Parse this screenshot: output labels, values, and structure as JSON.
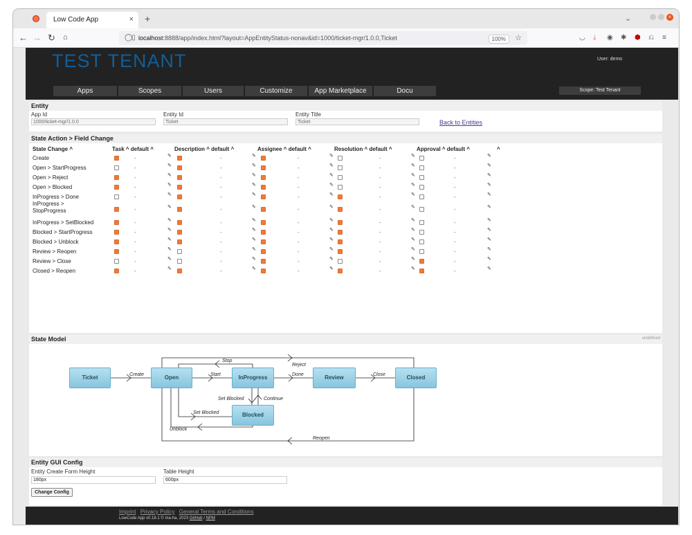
{
  "browser": {
    "tab_title": "Low Code App",
    "tab_close": "×",
    "new_tab": "+",
    "url_host": "localhost",
    "url_rest": ":8888/app/index.html?layout=AppEntityStatus-nonav&id=1000/ticket-mgr/1.0.0,Ticket",
    "zoom": "100%"
  },
  "header": {
    "tenant_name": "TEST TENANT",
    "user_label": "User:  demo",
    "scope_label": "Scope: Test Tenant",
    "menu": [
      "Apps",
      "Scopes",
      "Users",
      "Customize",
      "App Marketplace",
      "Docu"
    ]
  },
  "entity": {
    "section_title": "Entity",
    "app_id_label": "App Id",
    "app_id_value": "1000/ticket-mgr/1.0.0",
    "entity_id_label": "Entity Id",
    "entity_id_value": "Ticket",
    "entity_title_label": "Entity Title",
    "entity_title_value": "Ticket",
    "back_link": "Back to Entities"
  },
  "state_action": {
    "section_title": "State Action > Field Change",
    "columns": [
      "State Change ^",
      "Task ^ default ^",
      "Description ^ default ^",
      "Assignee ^ default ^",
      "Resolution ^ default ^",
      "Approval ^ default ^",
      "^"
    ],
    "rows": [
      {
        "label": "Create",
        "checks": [
          true,
          true,
          true,
          false,
          false
        ]
      },
      {
        "label": "Open > StartProgress",
        "checks": [
          false,
          true,
          true,
          false,
          false
        ]
      },
      {
        "label": "Open > Reject",
        "checks": [
          true,
          true,
          true,
          false,
          false
        ]
      },
      {
        "label": "Open > Blocked",
        "checks": [
          true,
          true,
          true,
          false,
          false
        ]
      },
      {
        "label": "InProgress > Done",
        "checks": [
          false,
          true,
          true,
          true,
          false
        ]
      },
      {
        "label": "InProgress > StopProgress",
        "checks": [
          true,
          true,
          true,
          true,
          false
        ]
      },
      {
        "label": "InProgress > SetBlocked",
        "checks": [
          true,
          true,
          true,
          true,
          false
        ]
      },
      {
        "label": "Blocked > StartProgress",
        "checks": [
          true,
          true,
          true,
          true,
          false
        ]
      },
      {
        "label": "Blocked > Unblock",
        "checks": [
          true,
          true,
          true,
          true,
          false
        ]
      },
      {
        "label": "Review > Reopen",
        "checks": [
          true,
          false,
          true,
          true,
          false
        ]
      },
      {
        "label": "Review > Close",
        "checks": [
          false,
          false,
          true,
          false,
          true
        ]
      },
      {
        "label": "Closed > Reopen",
        "checks": [
          true,
          true,
          true,
          true,
          true
        ]
      }
    ],
    "default_dash": "-"
  },
  "state_model": {
    "section_title": "State Model",
    "undefined_note": "undefined",
    "nodes": [
      "Ticket",
      "Open",
      "InProgress",
      "Review",
      "Closed",
      "Blocked"
    ],
    "edges": [
      "Create",
      "Start",
      "Done",
      "Close",
      "Stop",
      "Reject",
      "Set Blocked",
      "Continue",
      "Set Blocked",
      "Unblock",
      "Reopen"
    ]
  },
  "gui_config": {
    "section_title": "Entity GUI Config",
    "create_form_height_label": "Entity Create Form Height",
    "create_form_height_value": "180px",
    "table_height_label": "Table Height",
    "table_height_value": "600px",
    "change_button": "Change Config"
  },
  "footer": {
    "links": [
      "Imprint",
      "Privacy Policy",
      "General Terms and Conditions"
    ],
    "version_text": "LowCode App v0.18.1 © ma-ha, 2023",
    "github": "GitHub",
    "npm": "NPM"
  }
}
